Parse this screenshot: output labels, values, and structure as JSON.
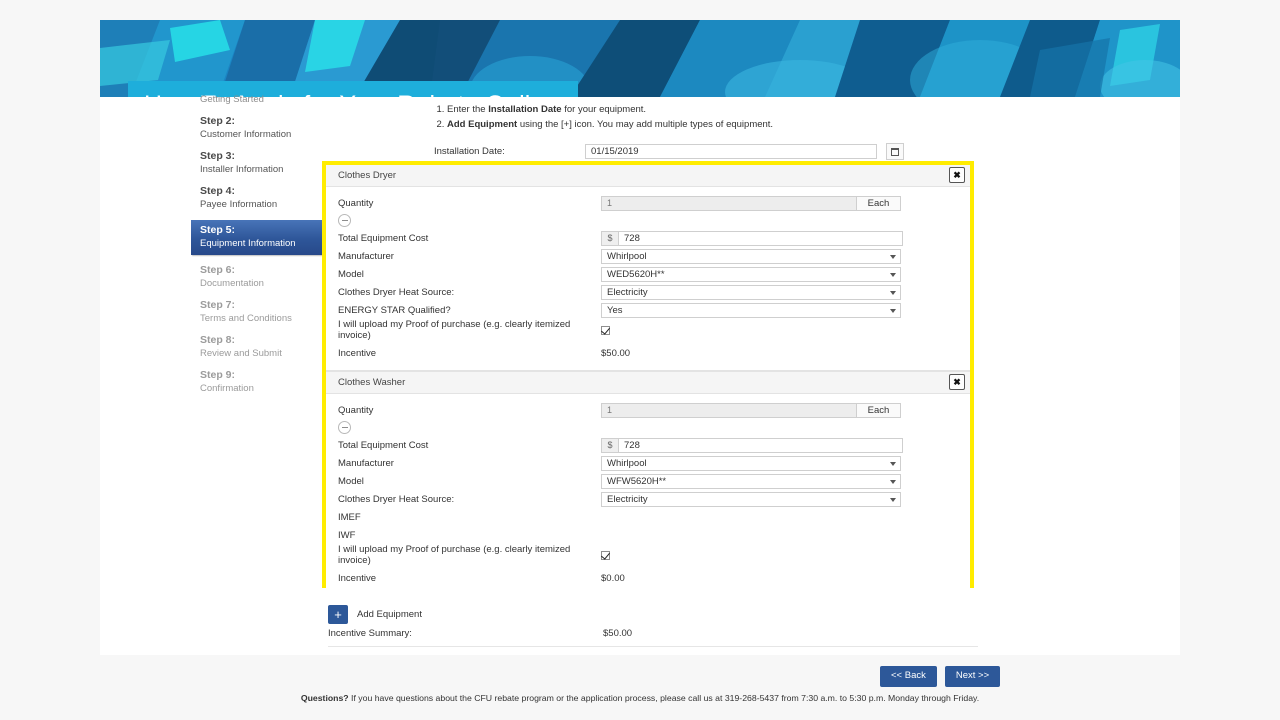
{
  "banner": {
    "title": "How To Apply for Your Rebate Online",
    "accent_color": "#1eaedb",
    "bg_color": "#1b85c4"
  },
  "sidebar": {
    "steps": [
      {
        "title": "",
        "sub": "Getting Started",
        "state": "cut"
      },
      {
        "title": "Step 2:",
        "sub": "Customer Information",
        "state": "done"
      },
      {
        "title": "Step 3:",
        "sub": "Installer Information",
        "state": "done"
      },
      {
        "title": "Step 4:",
        "sub": "Payee Information",
        "state": "done"
      },
      {
        "title": "Step 5:",
        "sub": "Equipment Information",
        "state": "active"
      },
      {
        "title": "Step 6:",
        "sub": "Documentation",
        "state": "muted"
      },
      {
        "title": "Step 7:",
        "sub": "Terms and Conditions",
        "state": "muted"
      },
      {
        "title": "Step 8:",
        "sub": "Review and Submit",
        "state": "muted"
      },
      {
        "title": "Step 9:",
        "sub": "Confirmation",
        "state": "muted"
      }
    ]
  },
  "instructions": {
    "item1_pre": "Enter the ",
    "item1_bold": "Installation Date",
    "item1_post": " for your equipment.",
    "item2_bold": "Add Equipment",
    "item2_post": " using the [+] icon. You may add multiple types of equipment."
  },
  "installation_date": {
    "label": "Installation Date:",
    "value": "01/15/2019",
    "calendar_icon": "calendar-icon"
  },
  "equipment": [
    {
      "name": "Clothes Dryer",
      "close_icon": "close-icon",
      "collapse_icon": "minus-circle-icon",
      "quantity_label": "Quantity",
      "quantity_value": "1",
      "quantity_unit": "Each",
      "cost_label": "Total Equipment Cost",
      "cost_prefix": "$",
      "cost_value": "728",
      "manufacturer_label": "Manufacturer",
      "manufacturer_value": "Whirlpool",
      "model_label": "Model",
      "model_value": "WED5620H**",
      "heat_source_label": "Clothes Dryer Heat Source:",
      "heat_source_value": "Electricity",
      "energy_star_label": "ENERGY STAR Qualified?",
      "energy_star_value": "Yes",
      "proof_label": "I will upload my Proof of purchase (e.g. clearly itemized invoice)",
      "proof_checked": true,
      "incentive_label": "Incentive",
      "incentive_value": "$50.00",
      "imef_label": null,
      "iwf_label": null
    },
    {
      "name": "Clothes Washer",
      "close_icon": "close-icon",
      "collapse_icon": "minus-circle-icon",
      "quantity_label": "Quantity",
      "quantity_value": "1",
      "quantity_unit": "Each",
      "cost_label": "Total Equipment Cost",
      "cost_prefix": "$",
      "cost_value": "728",
      "manufacturer_label": "Manufacturer",
      "manufacturer_value": "Whirlpool",
      "model_label": "Model",
      "model_value": "WFW5620H**",
      "heat_source_label": "Clothes Dryer Heat Source:",
      "heat_source_value": "Electricity",
      "energy_star_label": null,
      "energy_star_value": null,
      "imef_label": "IMEF",
      "iwf_label": "IWF",
      "proof_label": "I will upload my Proof of purchase (e.g. clearly itemized invoice)",
      "proof_checked": true,
      "incentive_label": "Incentive",
      "incentive_value": "$0.00"
    }
  ],
  "add_equipment": {
    "icon": "plus-icon",
    "label": "Add Equipment"
  },
  "incentive_summary": {
    "label": "Incentive Summary:",
    "value": "$50.00"
  },
  "footer": {
    "back_label": "<< Back",
    "next_label": "Next >>",
    "questions_bold": "Questions?",
    "questions_text": " If you have questions about the CFU rebate program or the application process, please call us at 319-268-5437 from 7:30 a.m. to 5:30 p.m. Monday through Friday."
  },
  "highlight": {
    "color": "#ffec00"
  }
}
